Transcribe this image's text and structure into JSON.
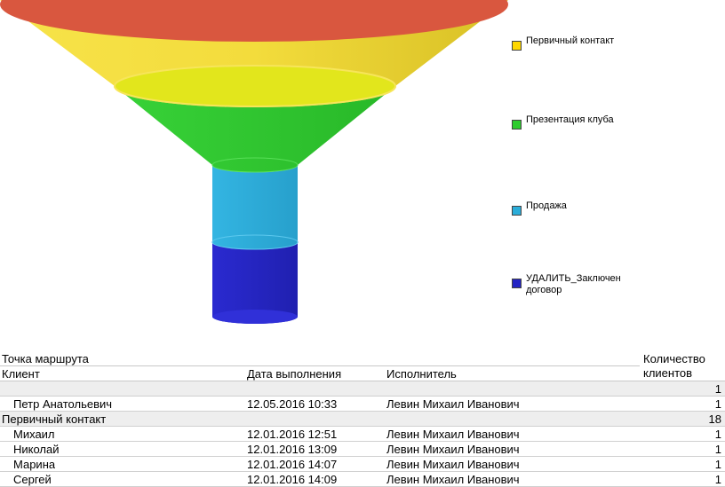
{
  "legend": [
    {
      "label": "Первичный контакт",
      "color": "#ffd700"
    },
    {
      "label": "Презентация клуба",
      "color": "#2ecc2e"
    },
    {
      "label": "Продажа",
      "color": "#2badd9"
    },
    {
      "label": "УДАЛИТЬ_Заключен договор",
      "color": "#2424c4"
    }
  ],
  "funnel_colors": {
    "top_ellipse": "#d9573f",
    "cone_1": "#f0d73a",
    "cone_2": "#2ecc2e",
    "cylinder_1": "#2badd9",
    "cylinder_2": "#2525c2"
  },
  "table": {
    "headers": {
      "route_point": "Точка маршрута",
      "client": "Клиент",
      "date": "Дата выполнения",
      "executor": "Исполнитель",
      "count_line1": "Количество",
      "count_line2": "клиентов"
    },
    "rows": [
      {
        "type": "group",
        "name": "",
        "count": "1"
      },
      {
        "type": "item",
        "client": "Петр Анатольевич",
        "date": "12.05.2016 10:33",
        "executor": "Левин Михаил Иванович",
        "count": "1"
      },
      {
        "type": "group",
        "name": "Первичный контакт",
        "count": "18"
      },
      {
        "type": "item",
        "client": "Михаил",
        "date": "12.01.2016 12:51",
        "executor": "Левин Михаил Иванович",
        "count": "1"
      },
      {
        "type": "item",
        "client": "Николай",
        "date": "12.01.2016 13:09",
        "executor": "Левин Михаил Иванович",
        "count": "1"
      },
      {
        "type": "item",
        "client": "Марина",
        "date": "12.01.2016 14:07",
        "executor": "Левин Михаил Иванович",
        "count": "1"
      },
      {
        "type": "item",
        "client": "Сергей",
        "date": "12.01.2016 14:09",
        "executor": "Левин Михаил Иванович",
        "count": "1"
      }
    ]
  }
}
